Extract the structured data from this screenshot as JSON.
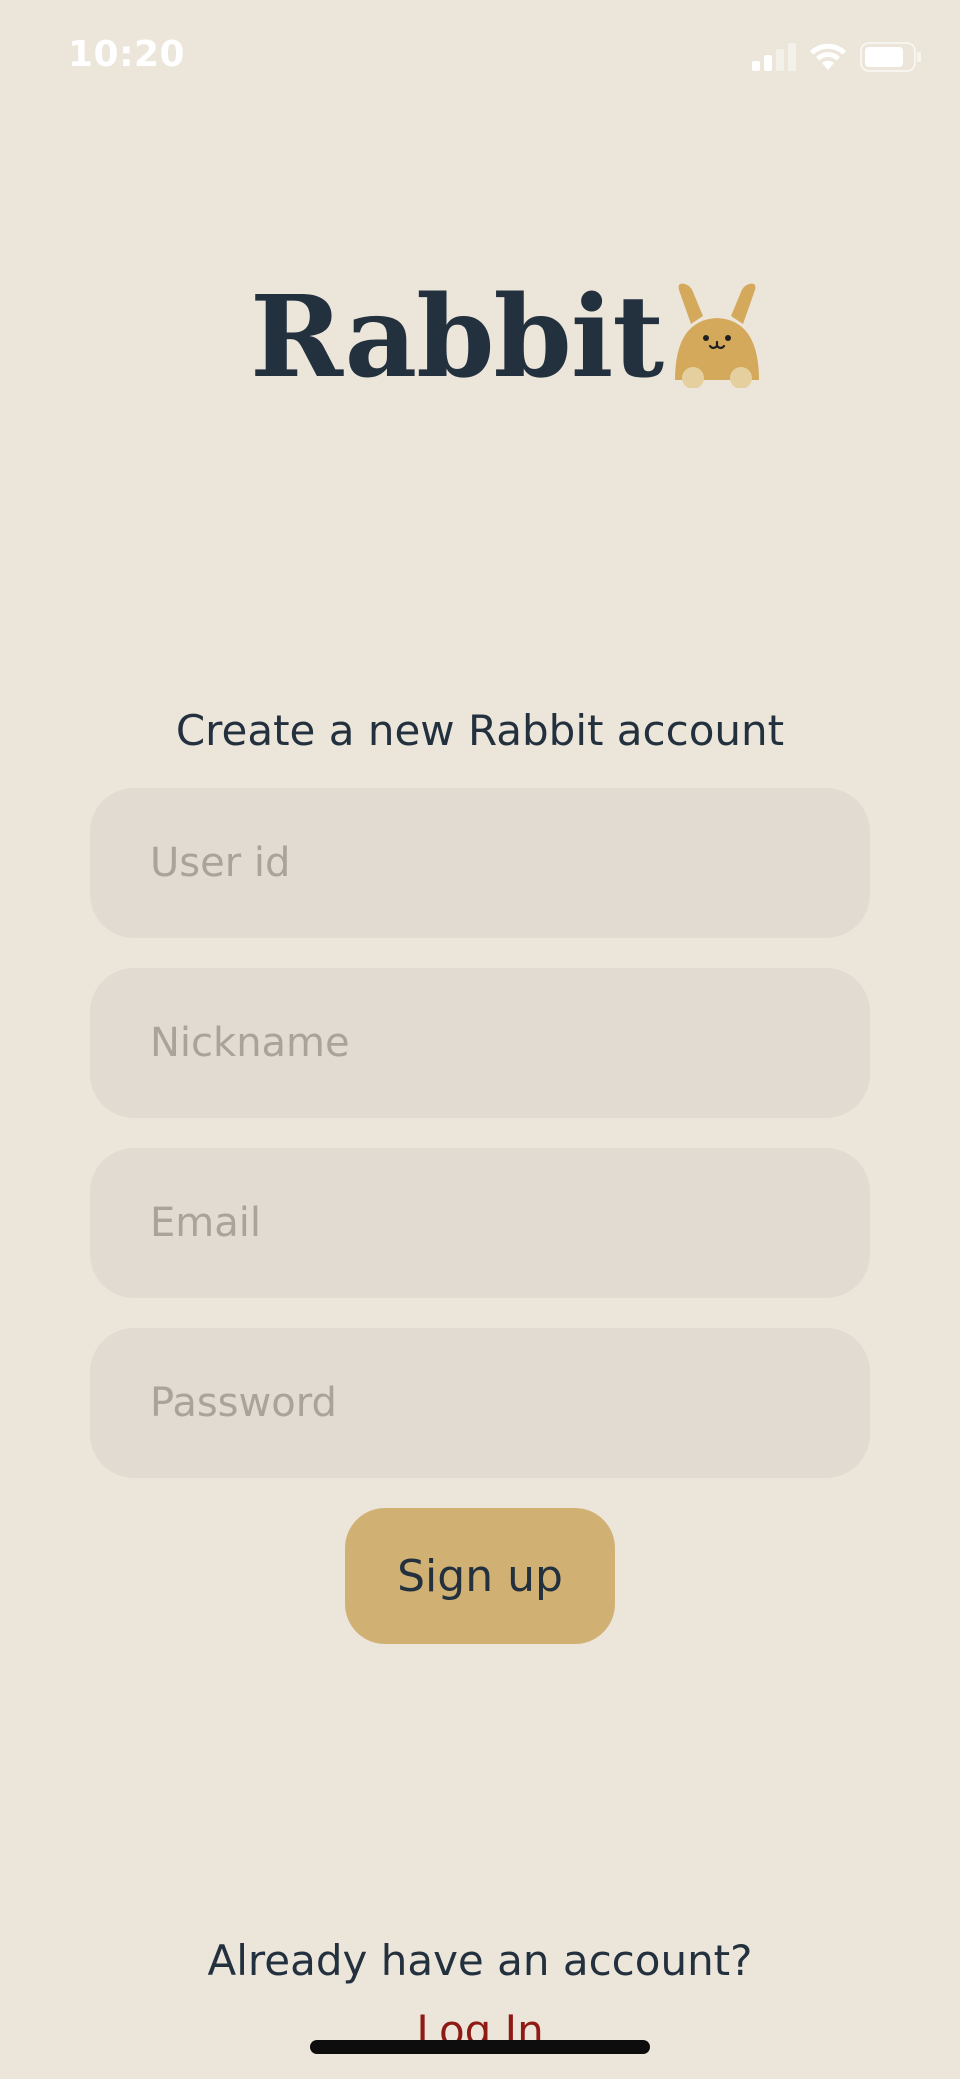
{
  "status_bar": {
    "time": "10:20",
    "icons": [
      "signal-icon",
      "wifi-icon",
      "battery-icon"
    ]
  },
  "logo": {
    "text": "Rabbit",
    "icon": "rabbit-mascot-icon"
  },
  "form": {
    "heading": "Create a new Rabbit account",
    "fields": {
      "user_id": {
        "placeholder": "User id",
        "value": ""
      },
      "nickname": {
        "placeholder": "Nickname",
        "value": ""
      },
      "email": {
        "placeholder": "Email",
        "value": ""
      },
      "password": {
        "placeholder": "Password",
        "value": ""
      }
    },
    "submit_label": "Sign up"
  },
  "footer": {
    "prompt": "Already have an account?",
    "login_label": "Log In"
  },
  "colors": {
    "background": "#ece5da",
    "field_background": "#e2dbd1",
    "button_background": "#d1b173",
    "text": "#23313f",
    "link": "#8f1a14",
    "mascot": "#d4a95c"
  }
}
